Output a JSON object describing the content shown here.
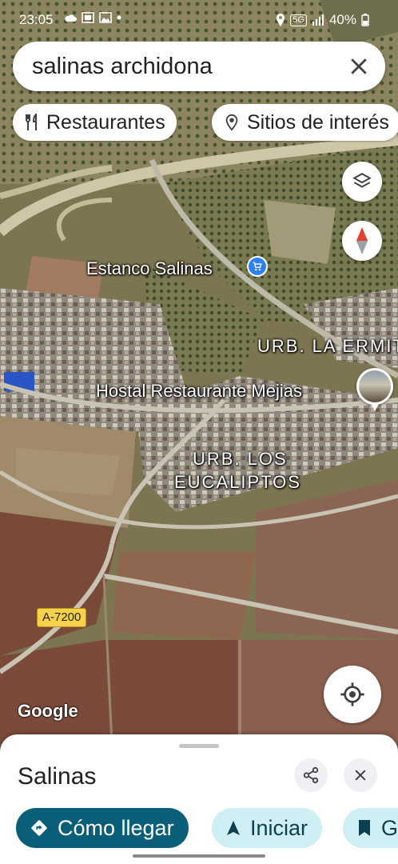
{
  "status_bar": {
    "time": "23:05",
    "network": "5G",
    "battery": "40%",
    "left_icons": [
      "cloud-icon",
      "cast-icon",
      "image-icon",
      "dot-icon"
    ],
    "right_icons": [
      "location-icon",
      "signal-icon",
      "battery-icon"
    ]
  },
  "search": {
    "query": "salinas archidona",
    "clear_icon": "close-icon"
  },
  "chips": [
    {
      "label": "Restaurantes",
      "icon": "fork-knife-icon"
    },
    {
      "label": "Sitios de interés",
      "icon": "camera-pin-icon"
    }
  ],
  "map": {
    "labels": {
      "estanco": "Estanco Salinas",
      "urb_ermita": "URB. LA ERMITA",
      "hostal": "Hostal Restaurante Mejias",
      "urb_eucaliptos_1": "URB. LOS",
      "urb_eucaliptos_2": "EUCALIPTOS",
      "road": "A-7200",
      "logo": "Google"
    },
    "buttons": [
      "layers-icon",
      "compass-icon",
      "my-location-icon"
    ]
  },
  "sheet": {
    "title": "Salinas",
    "actions": [
      {
        "label": "Cómo llegar",
        "icon": "directions-icon"
      },
      {
        "label": "Iniciar",
        "icon": "navigation-arrow-icon"
      },
      {
        "label": "Guardar",
        "icon": "bookmark-icon"
      }
    ]
  },
  "colors": {
    "primary_action": "#0b5e77",
    "secondary_action": "#cfeff5",
    "poi_blue": "#2f7ff5",
    "compass_red": "#e2412f"
  }
}
